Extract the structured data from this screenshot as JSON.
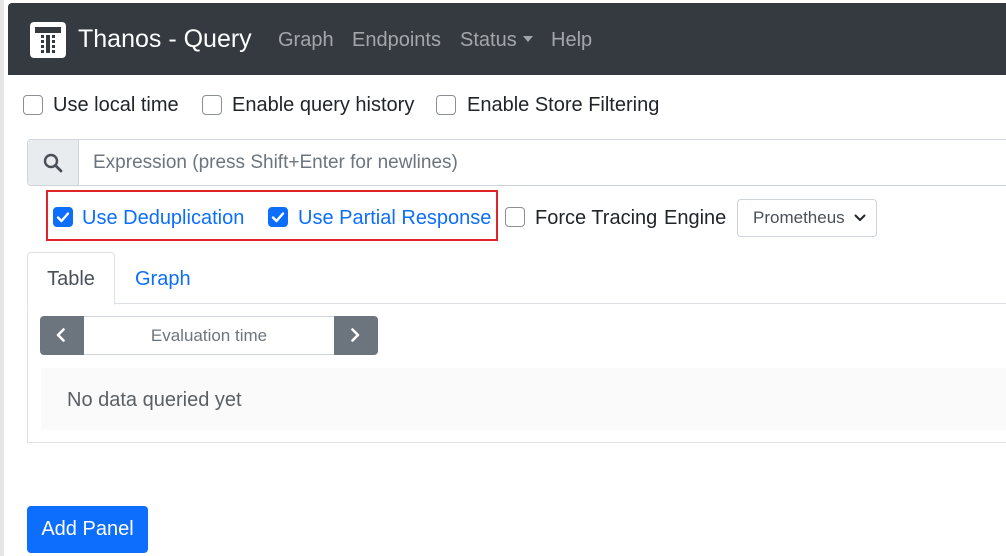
{
  "navbar": {
    "brand": "Thanos - Query",
    "links": [
      {
        "label": "Graph"
      },
      {
        "label": "Endpoints"
      },
      {
        "label": "Status"
      },
      {
        "label": "Help"
      }
    ]
  },
  "options": {
    "use_local_time": {
      "label": "Use local time",
      "checked": false
    },
    "enable_query_history": {
      "label": "Enable query history",
      "checked": false
    },
    "enable_store_filtering": {
      "label": "Enable Store Filtering",
      "checked": false
    }
  },
  "expression": {
    "placeholder": "Expression (press Shift+Enter for newlines)",
    "value": ""
  },
  "panel_options": {
    "use_deduplication": {
      "label": "Use Deduplication",
      "checked": true
    },
    "use_partial_response": {
      "label": "Use Partial Response",
      "checked": true
    },
    "force_tracing": {
      "label": "Force Tracing",
      "checked": false
    },
    "engine_label": "Engine",
    "engine_selected": "Prometheus"
  },
  "tabs": [
    {
      "label": "Table",
      "active": true
    },
    {
      "label": "Graph",
      "active": false
    }
  ],
  "table_view": {
    "evaluation_time_placeholder": "Evaluation time",
    "no_data_text": "No data queried yet"
  },
  "add_panel_label": "Add Panel",
  "colors": {
    "navbar_bg": "#343a40",
    "primary": "#0d6efd",
    "secondary": "#6c757d",
    "highlight": "#e0242c"
  }
}
